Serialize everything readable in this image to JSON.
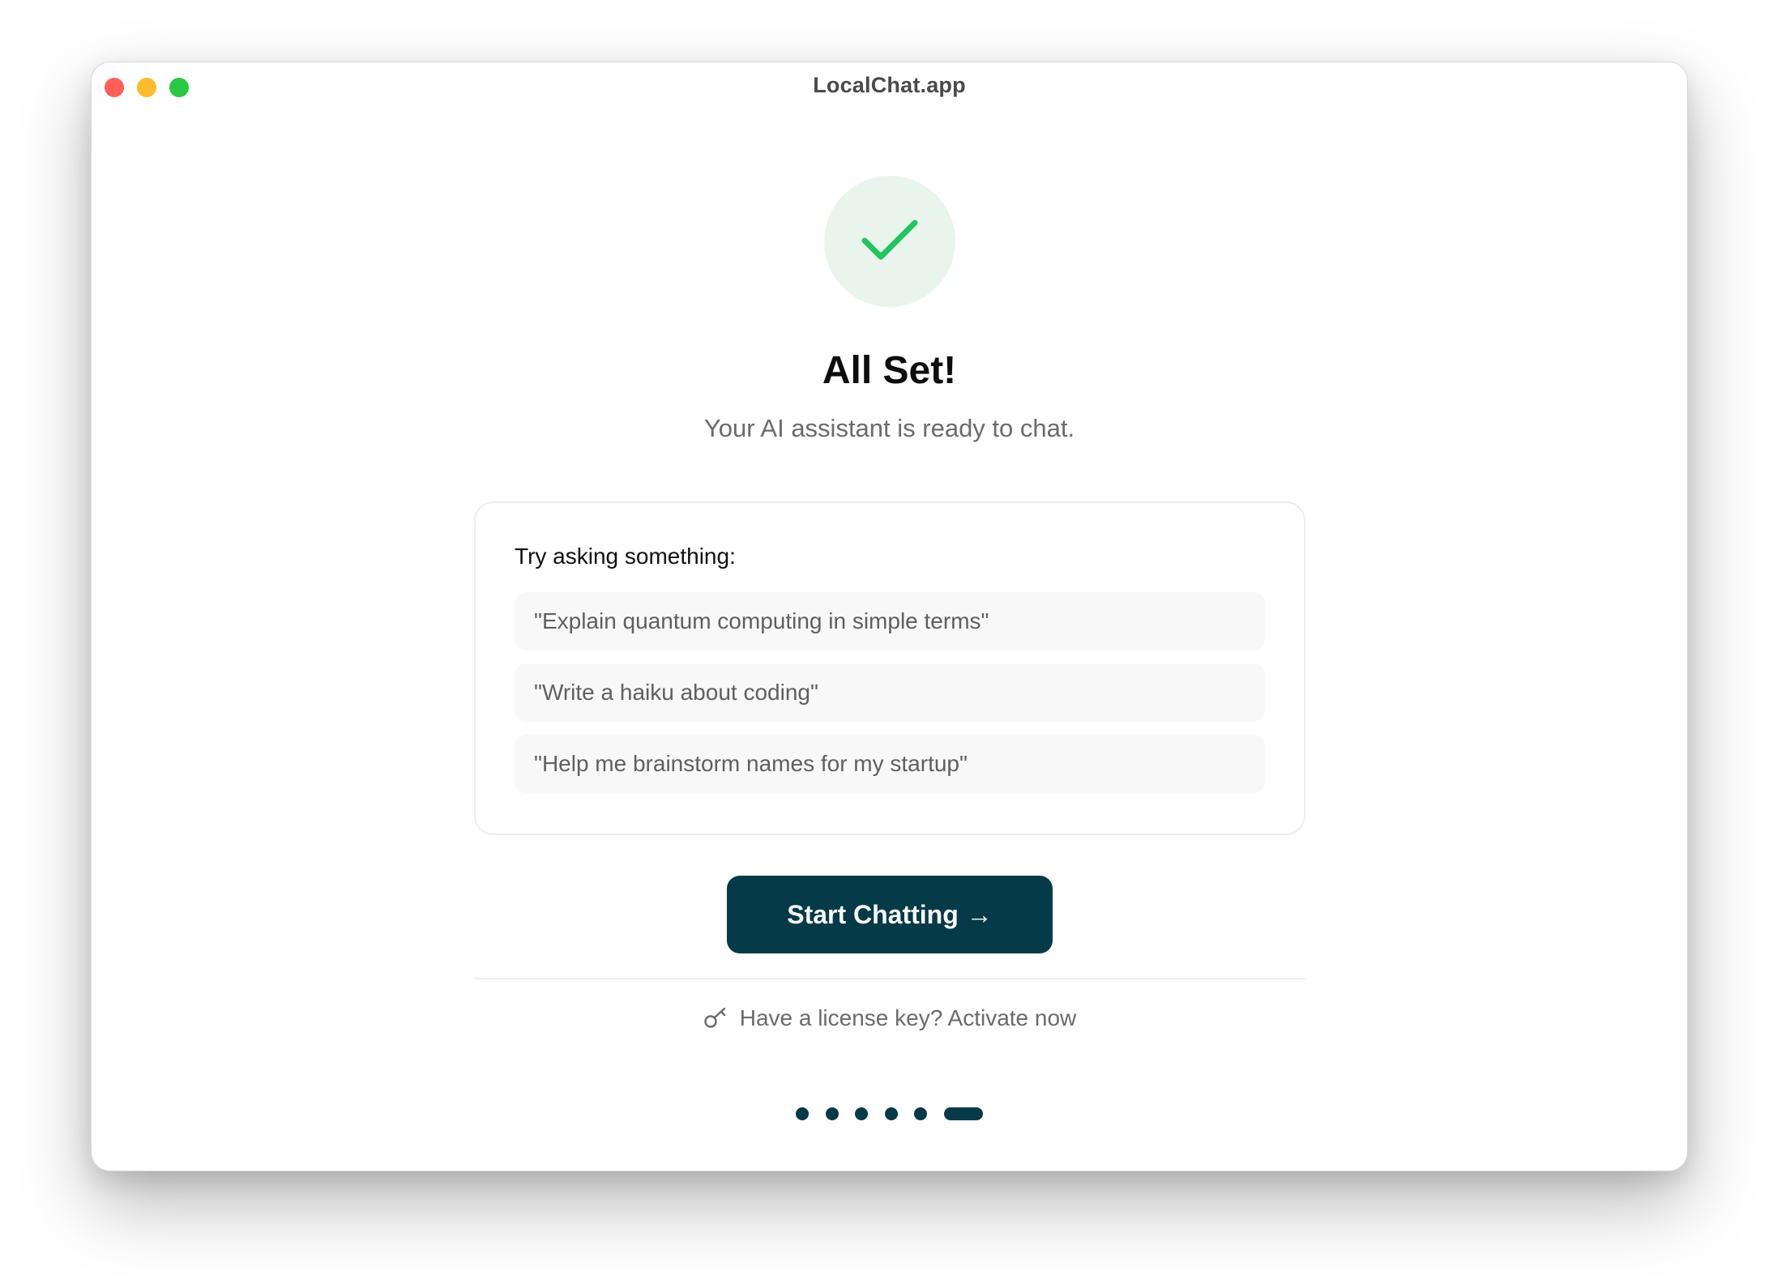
{
  "window": {
    "title": "LocalChat.app"
  },
  "onboarding": {
    "heading": "All Set!",
    "subheading": "Your AI assistant is ready to chat.",
    "suggestions_title": "Try asking something:",
    "suggestions": [
      "\"Explain quantum computing in simple terms\"",
      "\"Write a haiku about coding\"",
      "\"Help me brainstorm names for my startup\""
    ],
    "cta_label": "Start Chatting",
    "cta_arrow": "→",
    "license_text": "Have a license key? Activate now",
    "progress": {
      "total_steps": 6,
      "current_step": 6
    }
  },
  "icons": {
    "check": "checkmark-icon",
    "key": "key-icon"
  },
  "colors": {
    "accent": "#053a48",
    "success": "#22c55e",
    "success_bg": "#e9f5ec",
    "close": "#ff5f57",
    "minimize": "#febc2e",
    "maximize": "#28c840"
  }
}
